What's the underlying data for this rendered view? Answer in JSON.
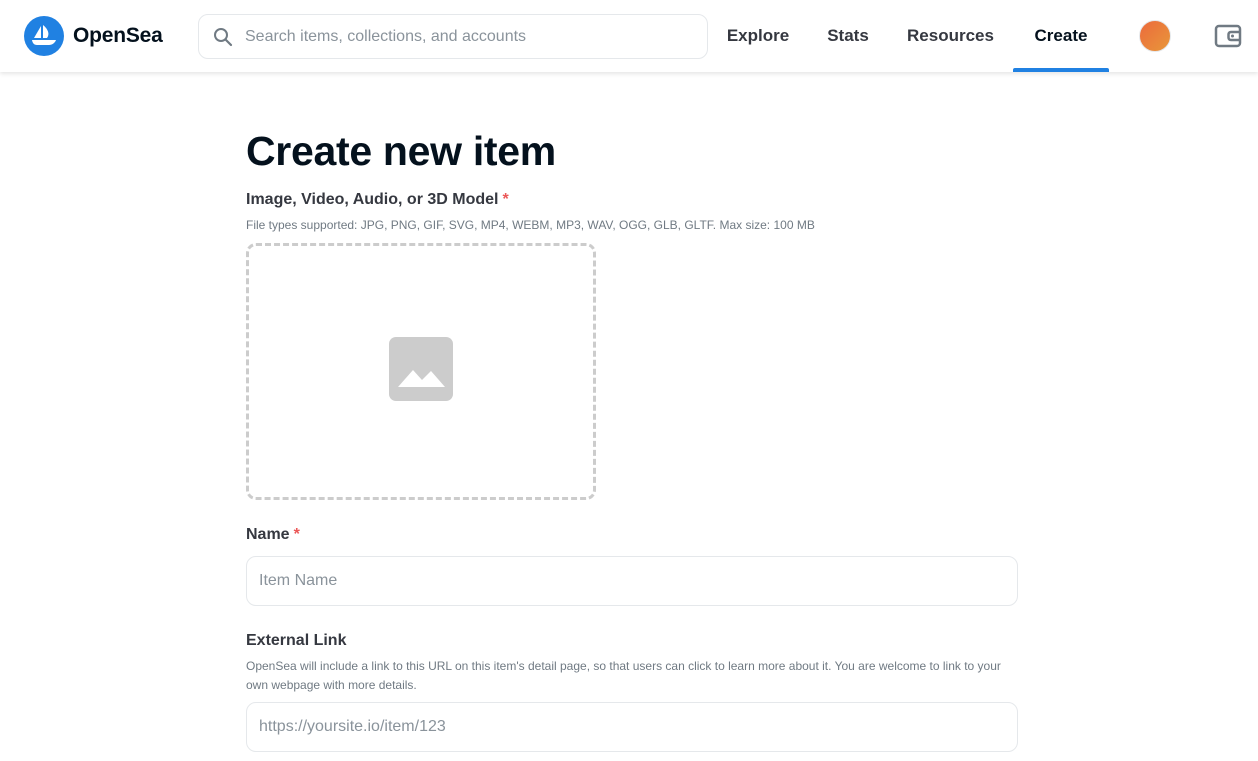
{
  "header": {
    "brand": "OpenSea",
    "search": {
      "placeholder": "Search items, collections, and accounts",
      "value": ""
    },
    "nav": [
      {
        "label": "Explore",
        "active": false
      },
      {
        "label": "Stats",
        "active": false
      },
      {
        "label": "Resources",
        "active": false
      },
      {
        "label": "Create",
        "active": true
      }
    ],
    "icons": {
      "logo": "opensea-logo-icon",
      "search": "search-icon",
      "avatar": "avatar",
      "wallet": "wallet-icon"
    }
  },
  "main": {
    "title": "Create new item",
    "media": {
      "label": "Image, Video, Audio, or 3D Model",
      "required_mark": "*",
      "help": "File types supported: JPG, PNG, GIF, SVG, MP4, WEBM, MP3, WAV, OGG, GLB, GLTF. Max size: 100 MB",
      "icon": "image-placeholder-icon"
    },
    "name": {
      "label": "Name",
      "required_mark": "*",
      "placeholder": "Item Name",
      "value": ""
    },
    "external_link": {
      "label": "External Link",
      "help": "OpenSea will include a link to this URL on this item's detail page, so that users can click to learn more about it. You are welcome to link to your own webpage with more details.",
      "placeholder": "https://yoursite.io/item/123",
      "value": ""
    }
  },
  "colors": {
    "brand_blue": "#2081e2",
    "text_primary": "#04111d",
    "text_secondary": "#353840",
    "muted": "#707a83",
    "required": "#eb5757",
    "border": "#e5e8eb",
    "dashed_border": "#cccccc"
  }
}
